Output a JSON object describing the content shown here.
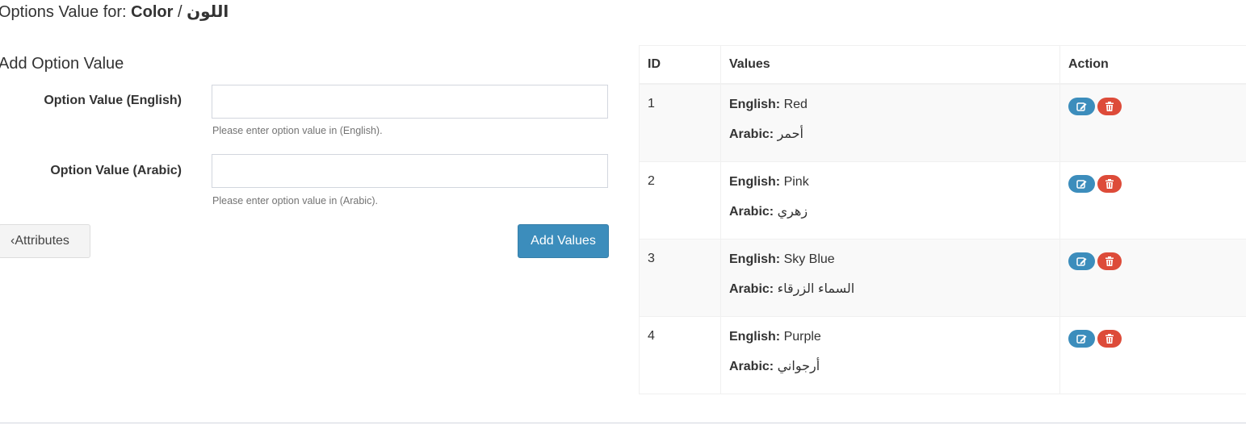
{
  "header": {
    "title_prefix": "Options Value for: ",
    "option_name": "Color",
    "separator": " / ",
    "option_name_arabic": "اللون"
  },
  "form": {
    "section_title": "Add Option Value",
    "english": {
      "label": "Option Value (English)",
      "value": "",
      "help": "Please enter option value in (English)."
    },
    "arabic": {
      "label": "Option Value (Arabic)",
      "value": "",
      "help": "Please enter option value in (Arabic)."
    },
    "back_button": "Attributes",
    "back_icon": "chevron-left-icon",
    "submit_button": "Add Values"
  },
  "table": {
    "headers": [
      "ID",
      "Values",
      "Action"
    ],
    "english_label": "English:",
    "arabic_label": "Arabic:",
    "rows": [
      {
        "id": "1",
        "english": "Red",
        "arabic": "أحمر"
      },
      {
        "id": "2",
        "english": "Pink",
        "arabic": "زهري"
      },
      {
        "id": "3",
        "english": "Sky Blue",
        "arabic": "السماء الزرقاء"
      },
      {
        "id": "4",
        "english": "Purple",
        "arabic": "أرجواني"
      }
    ],
    "edit_icon": "edit-icon",
    "delete_icon": "trash-icon"
  },
  "colors": {
    "primary": "#3c8dbc",
    "danger": "#dd4b39",
    "default_button": "#f4f4f4",
    "striped_row": "#f9f9f9"
  }
}
